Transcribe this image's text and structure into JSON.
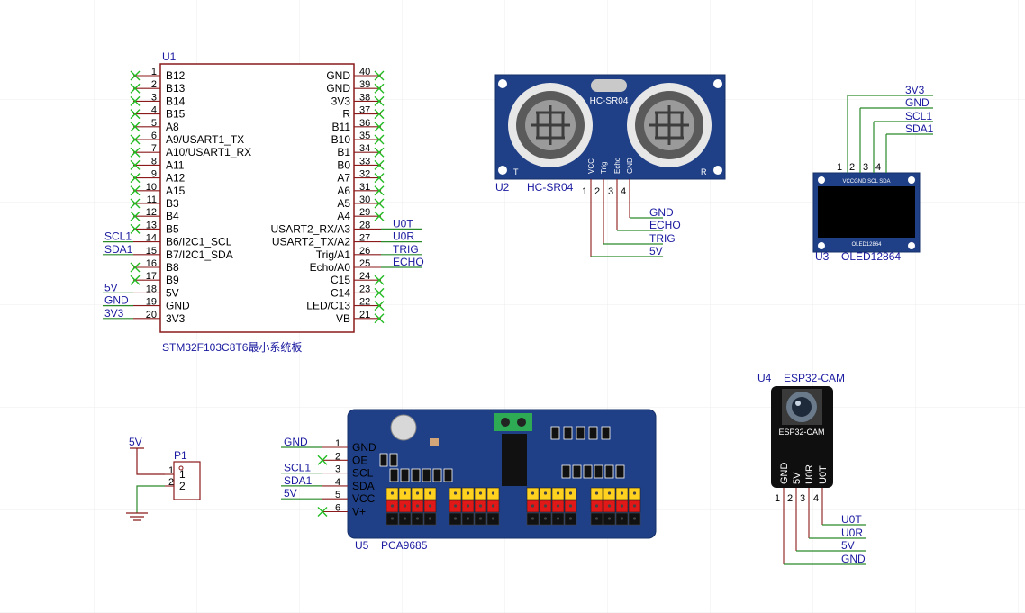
{
  "colors": {
    "wire": "#2a8a2a",
    "box": "#8b1a1a",
    "netlabel": "#1a1aa0",
    "noconnect": "#22bb22",
    "board": "#1f3f86"
  },
  "u1": {
    "ref": "U1",
    "name": "STM32F103C8T6最小系统板",
    "left_pins": [
      {
        "num": "1",
        "name": "B12",
        "net": ""
      },
      {
        "num": "2",
        "name": "B13",
        "net": ""
      },
      {
        "num": "3",
        "name": "B14",
        "net": ""
      },
      {
        "num": "4",
        "name": "B15",
        "net": ""
      },
      {
        "num": "5",
        "name": "A8",
        "net": ""
      },
      {
        "num": "6",
        "name": "A9/USART1_TX",
        "net": ""
      },
      {
        "num": "7",
        "name": "A10/USART1_RX",
        "net": ""
      },
      {
        "num": "8",
        "name": "A11",
        "net": ""
      },
      {
        "num": "9",
        "name": "A12",
        "net": ""
      },
      {
        "num": "10",
        "name": "A15",
        "net": ""
      },
      {
        "num": "11",
        "name": "B3",
        "net": ""
      },
      {
        "num": "12",
        "name": "B4",
        "net": ""
      },
      {
        "num": "13",
        "name": "B5",
        "net": ""
      },
      {
        "num": "14",
        "name": "B6/I2C1_SCL",
        "net": "SCL1"
      },
      {
        "num": "15",
        "name": "B7/I2C1_SDA",
        "net": "SDA1"
      },
      {
        "num": "16",
        "name": "B8",
        "net": ""
      },
      {
        "num": "17",
        "name": "B9",
        "net": ""
      },
      {
        "num": "18",
        "name": "5V",
        "net": "5V"
      },
      {
        "num": "19",
        "name": "GND",
        "net": "GND"
      },
      {
        "num": "20",
        "name": "3V3",
        "net": "3V3"
      }
    ],
    "right_pins": [
      {
        "num": "40",
        "name": "GND",
        "net": ""
      },
      {
        "num": "39",
        "name": "GND",
        "net": ""
      },
      {
        "num": "38",
        "name": "3V3",
        "net": ""
      },
      {
        "num": "37",
        "name": "R",
        "net": ""
      },
      {
        "num": "36",
        "name": "B11",
        "net": ""
      },
      {
        "num": "35",
        "name": "B10",
        "net": ""
      },
      {
        "num": "34",
        "name": "B1",
        "net": ""
      },
      {
        "num": "33",
        "name": "B0",
        "net": ""
      },
      {
        "num": "32",
        "name": "A7",
        "net": ""
      },
      {
        "num": "31",
        "name": "A6",
        "net": ""
      },
      {
        "num": "30",
        "name": "A5",
        "net": ""
      },
      {
        "num": "29",
        "name": "A4",
        "net": ""
      },
      {
        "num": "28",
        "name": "USART2_RX/A3",
        "net": "U0T"
      },
      {
        "num": "27",
        "name": "USART2_TX/A2",
        "net": "U0R"
      },
      {
        "num": "26",
        "name": "Trig/A1",
        "net": "TRIG"
      },
      {
        "num": "25",
        "name": "Echo/A0",
        "net": "ECHO"
      },
      {
        "num": "24",
        "name": "C15",
        "net": ""
      },
      {
        "num": "23",
        "name": "C14",
        "net": ""
      },
      {
        "num": "22",
        "name": "LED/C13",
        "net": ""
      },
      {
        "num": "21",
        "name": "VB",
        "net": ""
      }
    ]
  },
  "u2": {
    "ref": "U2",
    "name": "HC-SR04",
    "board_label": "HC-SR04",
    "corner_t": "T",
    "corner_r": "R",
    "pins": [
      {
        "num": "1",
        "name": "VCC",
        "net": "5V"
      },
      {
        "num": "2",
        "name": "Trig",
        "net": "TRIG"
      },
      {
        "num": "3",
        "name": "Echo",
        "net": "ECHO"
      },
      {
        "num": "4",
        "name": "GND",
        "net": "GND"
      }
    ]
  },
  "u3": {
    "ref": "U3",
    "name": "OLED12864",
    "board_header": "VCCGND SCL SDA",
    "board_label": "OLED12864",
    "pins": [
      {
        "num": "1",
        "net": "3V3"
      },
      {
        "num": "2",
        "net": "GND"
      },
      {
        "num": "3",
        "net": "SCL1"
      },
      {
        "num": "4",
        "net": "SDA1"
      }
    ]
  },
  "u4": {
    "ref": "U4",
    "name": "ESP32-CAM",
    "board_label": "ESP32-CAM",
    "pins": [
      {
        "num": "1",
        "name": "GND",
        "net": "GND"
      },
      {
        "num": "2",
        "name": "5V",
        "net": "5V"
      },
      {
        "num": "3",
        "name": "U0R",
        "net": "U0R"
      },
      {
        "num": "4",
        "name": "U0T",
        "net": "U0T"
      }
    ]
  },
  "u5": {
    "ref": "U5",
    "name": "PCA9685",
    "pins": [
      {
        "num": "1",
        "name": "GND",
        "net": "GND"
      },
      {
        "num": "2",
        "name": "OE",
        "net": ""
      },
      {
        "num": "3",
        "name": "SCL",
        "net": "SCL1"
      },
      {
        "num": "4",
        "name": "SDA",
        "net": "SDA1"
      },
      {
        "num": "5",
        "name": "VCC",
        "net": "5V"
      },
      {
        "num": "6",
        "name": "V+",
        "net": ""
      }
    ]
  },
  "p1": {
    "ref": "P1",
    "net": "5V",
    "pins": [
      {
        "num": "1",
        "label": "1"
      },
      {
        "num": "2",
        "label": "2"
      }
    ]
  }
}
